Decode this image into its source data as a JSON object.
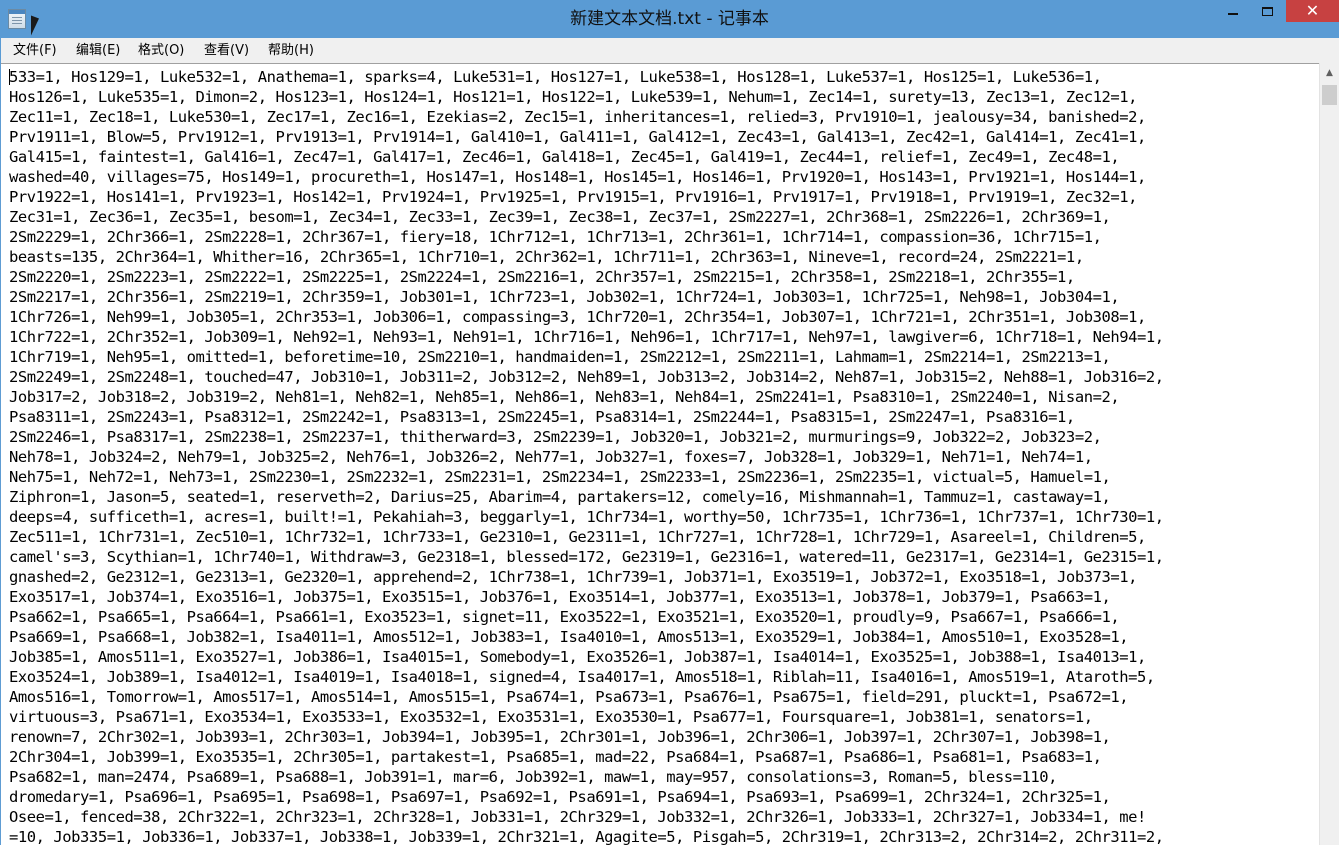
{
  "window": {
    "title": "新建文本文档.txt - 记事本",
    "close_glyph": "✕"
  },
  "menu": [
    {
      "label": "文件(F)"
    },
    {
      "label": "编辑(E)"
    },
    {
      "label": "格式(O)"
    },
    {
      "label": "查看(V)"
    },
    {
      "label": "帮助(H)"
    }
  ],
  "editor": {
    "lines": [
      "533=1, Hos129=1, Luke532=1, Anathema=1, sparks=4, Luke531=1, Hos127=1, Luke538=1, Hos128=1, Luke537=1, Hos125=1, Luke536=1,",
      "Hos126=1, Luke535=1, Dimon=2, Hos123=1, Hos124=1, Hos121=1, Hos122=1, Luke539=1, Nehum=1, Zec14=1, surety=13, Zec13=1, Zec12=1,",
      "Zec11=1, Zec18=1, Luke530=1, Zec17=1, Zec16=1, Ezekias=2, Zec15=1, inheritances=1, relied=3, Prv1910=1, jealousy=34, banished=2,",
      "Prv1911=1, Blow=5, Prv1912=1, Prv1913=1, Prv1914=1, Gal410=1, Gal411=1, Gal412=1, Zec43=1, Gal413=1, Zec42=1, Gal414=1, Zec41=1,",
      "Gal415=1, faintest=1, Gal416=1, Zec47=1, Gal417=1, Zec46=1, Gal418=1, Zec45=1, Gal419=1, Zec44=1, relief=1, Zec49=1, Zec48=1,",
      "washed=40, villages=75, Hos149=1, procureth=1, Hos147=1, Hos148=1, Hos145=1, Hos146=1, Prv1920=1, Hos143=1, Prv1921=1, Hos144=1,",
      "Prv1922=1, Hos141=1, Prv1923=1, Hos142=1, Prv1924=1, Prv1925=1, Prv1915=1, Prv1916=1, Prv1917=1, Prv1918=1, Prv1919=1, Zec32=1,",
      "Zec31=1, Zec36=1, Zec35=1, besom=1, Zec34=1, Zec33=1, Zec39=1, Zec38=1, Zec37=1, 2Sm2227=1, 2Chr368=1, 2Sm2226=1, 2Chr369=1,",
      "2Sm2229=1, 2Chr366=1, 2Sm2228=1, 2Chr367=1, fiery=18, 1Chr712=1, 1Chr713=1, 2Chr361=1, 1Chr714=1, compassion=36, 1Chr715=1,",
      "beasts=135, 2Chr364=1, Whither=16, 2Chr365=1, 1Chr710=1, 2Chr362=1, 1Chr711=1, 2Chr363=1, Nineve=1, record=24, 2Sm2221=1,",
      "2Sm2220=1, 2Sm2223=1, 2Sm2222=1, 2Sm2225=1, 2Sm2224=1, 2Sm2216=1, 2Chr357=1, 2Sm2215=1, 2Chr358=1, 2Sm2218=1, 2Chr355=1,",
      "2Sm2217=1, 2Chr356=1, 2Sm2219=1, 2Chr359=1, Job301=1, 1Chr723=1, Job302=1, 1Chr724=1, Job303=1, 1Chr725=1, Neh98=1, Job304=1,",
      "1Chr726=1, Neh99=1, Job305=1, 2Chr353=1, Job306=1, compassing=3, 1Chr720=1, 2Chr354=1, Job307=1, 1Chr721=1, 2Chr351=1, Job308=1,",
      "1Chr722=1, 2Chr352=1, Job309=1, Neh92=1, Neh93=1, Neh91=1, 1Chr716=1, Neh96=1, 1Chr717=1, Neh97=1, lawgiver=6, 1Chr718=1, Neh94=1,",
      "1Chr719=1, Neh95=1, omitted=1, beforetime=10, 2Sm2210=1, handmaiden=1, 2Sm2212=1, 2Sm2211=1, Lahmam=1, 2Sm2214=1, 2Sm2213=1,",
      "2Sm2249=1, 2Sm2248=1, touched=47, Job310=1, Job311=2, Job312=2, Neh89=1, Job313=2, Job314=2, Neh87=1, Job315=2, Neh88=1, Job316=2,",
      "Job317=2, Job318=2, Job319=2, Neh81=1, Neh82=1, Neh85=1, Neh86=1, Neh83=1, Neh84=1, 2Sm2241=1, Psa8310=1, 2Sm2240=1, Nisan=2,",
      "Psa8311=1, 2Sm2243=1, Psa8312=1, 2Sm2242=1, Psa8313=1, 2Sm2245=1, Psa8314=1, 2Sm2244=1, Psa8315=1, 2Sm2247=1, Psa8316=1,",
      "2Sm2246=1, Psa8317=1, 2Sm2238=1, 2Sm2237=1, thitherward=3, 2Sm2239=1, Job320=1, Job321=2, murmurings=9, Job322=2, Job323=2,",
      "Neh78=1, Job324=2, Neh79=1, Job325=2, Neh76=1, Job326=2, Neh77=1, Job327=1, foxes=7, Job328=1, Job329=1, Neh71=1, Neh74=1,",
      "Neh75=1, Neh72=1, Neh73=1, 2Sm2230=1, 2Sm2232=1, 2Sm2231=1, 2Sm2234=1, 2Sm2233=1, 2Sm2236=1, 2Sm2235=1, victual=5, Hamuel=1,",
      "Ziphron=1, Jason=5, seated=1, reserveth=2, Darius=25, Abarim=4, partakers=12, comely=16, Mishmannah=1, Tammuz=1, castaway=1,",
      "deeps=4, sufficeth=1, acres=1, built!=1, Pekahiah=3, beggarly=1, 1Chr734=1, worthy=50, 1Chr735=1, 1Chr736=1, 1Chr737=1, 1Chr730=1,",
      "Zec511=1, 1Chr731=1, Zec510=1, 1Chr732=1, 1Chr733=1, Ge2310=1, Ge2311=1, 1Chr727=1, 1Chr728=1, 1Chr729=1, Asareel=1, Children=5,",
      "camel's=3, Scythian=1, 1Chr740=1, Withdraw=3, Ge2318=1, blessed=172, Ge2319=1, Ge2316=1, watered=11, Ge2317=1, Ge2314=1, Ge2315=1,",
      "gnashed=2, Ge2312=1, Ge2313=1, Ge2320=1, apprehend=2, 1Chr738=1, 1Chr739=1, Job371=1, Exo3519=1, Job372=1, Exo3518=1, Job373=1,",
      "Exo3517=1, Job374=1, Exo3516=1, Job375=1, Exo3515=1, Job376=1, Exo3514=1, Job377=1, Exo3513=1, Job378=1, Job379=1, Psa663=1,",
      "Psa662=1, Psa665=1, Psa664=1, Psa661=1, Exo3523=1, signet=11, Exo3522=1, Exo3521=1, Exo3520=1, proudly=9, Psa667=1, Psa666=1,",
      "Psa669=1, Psa668=1, Job382=1, Isa4011=1, Amos512=1, Job383=1, Isa4010=1, Amos513=1, Exo3529=1, Job384=1, Amos510=1, Exo3528=1,",
      "Job385=1, Amos511=1, Exo3527=1, Job386=1, Isa4015=1, Somebody=1, Exo3526=1, Job387=1, Isa4014=1, Exo3525=1, Job388=1, Isa4013=1,",
      "Exo3524=1, Job389=1, Isa4012=1, Isa4019=1, Isa4018=1, signed=4, Isa4017=1, Amos518=1, Riblah=11, Isa4016=1, Amos519=1, Ataroth=5,",
      "Amos516=1, Tomorrow=1, Amos517=1, Amos514=1, Amos515=1, Psa674=1, Psa673=1, Psa676=1, Psa675=1, field=291, pluckt=1, Psa672=1,",
      "virtuous=3, Psa671=1, Exo3534=1, Exo3533=1, Exo3532=1, Exo3531=1, Exo3530=1, Psa677=1, Foursquare=1, Job381=1, senators=1,",
      "renown=7, 2Chr302=1, Job393=1, 2Chr303=1, Job394=1, Job395=1, 2Chr301=1, Job396=1, 2Chr306=1, Job397=1, 2Chr307=1, Job398=1,",
      "2Chr304=1, Job399=1, Exo3535=1, 2Chr305=1, partakest=1, Psa685=1, mad=22, Psa684=1, Psa687=1, Psa686=1, Psa681=1, Psa683=1,",
      "Psa682=1, man=2474, Psa689=1, Psa688=1, Job391=1, mar=6, Job392=1, maw=1, may=957, consolations=3, Roman=5, bless=110,",
      "dromedary=1, Psa696=1, Psa695=1, Psa698=1, Psa697=1, Psa692=1, Psa691=1, Psa694=1, Psa693=1, Psa699=1, 2Chr324=1, 2Chr325=1,",
      "Osee=1, fenced=38, 2Chr322=1, 2Chr323=1, 2Chr328=1, Job331=1, 2Chr329=1, Job332=1, 2Chr326=1, Job333=1, 2Chr327=1, Job334=1, me!",
      "=10, Job335=1, Job336=1, Job337=1, Job338=1, Job339=1, 2Chr321=1, Agagite=5, Pisgah=5, 2Chr319=1, 2Chr313=2, 2Chr314=2, 2Chr311=2,"
    ]
  },
  "scrollbar": {
    "up_arrow": "▲"
  }
}
